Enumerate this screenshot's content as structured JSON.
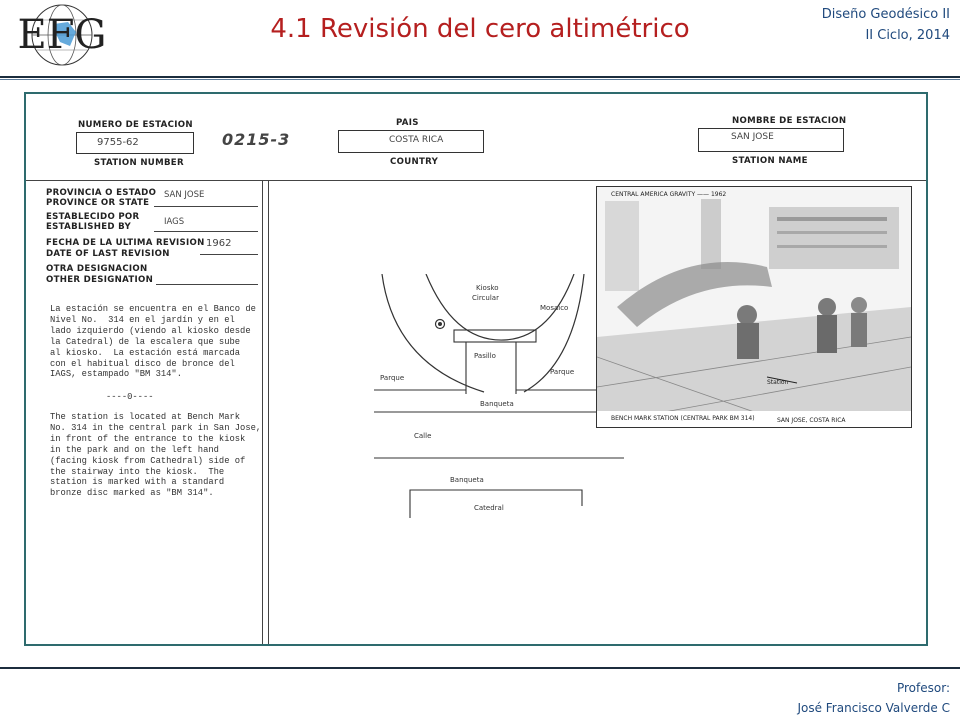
{
  "header": {
    "logo_text": "EFG",
    "title": "4.1 Revisión del cero altimétrico",
    "course_line1": "Diseño Geodésico II",
    "course_line2": "II Ciclo, 2014"
  },
  "footer": {
    "line1": "Profesor:",
    "line2": "José Francisco Valverde C"
  },
  "form": {
    "station_number_label_es": "NUMERO DE ESTACION",
    "station_number_value": "9755-62",
    "station_number_label_en": "STATION NUMBER",
    "handwritten_code": "0215-3",
    "country_label_es": "PAIS",
    "country_value": "COSTA RICA",
    "country_label_en": "COUNTRY",
    "station_name_label_es": "NOMBRE DE ESTACION",
    "station_name_value": "SAN JOSE",
    "station_name_label_en": "STATION NAME",
    "province_label_es": "PROVINCIA O ESTADO",
    "province_label_en": "PROVINCE OR STATE",
    "province_value": "SAN JOSE",
    "established_label_es": "ESTABLECIDO POR",
    "established_label_en": "ESTABLISHED BY",
    "established_value": "IAGS",
    "last_revision_label_es": "FECHA DE LA ULTIMA REVISION",
    "last_revision_label_en": "DATE OF LAST REVISION",
    "last_revision_value": "1962",
    "other_designation_label_es": "OTRA DESIGNACION",
    "other_designation_label_en": "OTHER DESIGNATION"
  },
  "description": {
    "spanish": "La estación se encuentra en el Banco de\nNivel No.  314 en el jardín y en el\nlado izquierdo (viendo al kiosko desde\nla Catedral) de la escalera que sube\nal kiosko.  La estación está marcada\ncon el habitual disco de bronce del\nIAGS, estampado \"BM 314\".",
    "separator": "----0----",
    "english": "The station is located at Bench Mark\nNo. 314 in the central park in San Jose,\nin front of the entrance to the kiosk\nin the park and on the left hand\n(facing kiosk from Cathedral) side of\nthe stairway into the kiosk.  The\nstation is marked with a standard\nbronze disc marked as \"BM 314\"."
  },
  "map": {
    "kiosk_line1": "Kiosko",
    "kiosk_line2": "Circular",
    "mosaic": "Mosaico",
    "aisle": "Pasillo",
    "park_left": "Parque",
    "park_right": "Parque",
    "sidewalk_top": "Banqueta",
    "street": "Calle",
    "sidewalk_bottom": "Banqueta",
    "cathedral": "Catedral"
  },
  "photo": {
    "top_caption": "CENTRAL AMERICA  GRAVITY —— 1962",
    "station_label": "Station",
    "bottom_caption_left": "BENCH MARK STATION (CENTRAL PARK BM 314)",
    "bottom_caption_right": "SAN JOSE, COSTA RICA"
  },
  "colors": {
    "title": "#b51f1f",
    "header_text": "#1f497d",
    "frame_border": "#2e6b6e"
  }
}
